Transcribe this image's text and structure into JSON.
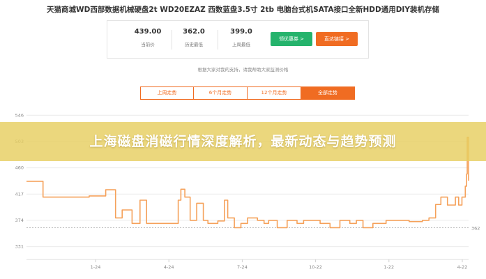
{
  "product": {
    "title": "天猫商城WD西部数据机械硬盘2t WD20EZAZ 西数蓝盘3.5寸 2tb 电脑台式机SATA接口全新HDD通用DIY装机存储"
  },
  "price_panel": {
    "stats": [
      {
        "value": "439.00",
        "label": "当前价"
      },
      {
        "value": "362.0",
        "label": "历史最低"
      },
      {
        "value": "399.0",
        "label": "上周最低"
      }
    ],
    "buttons": {
      "coupon": "领优惠券 >",
      "buy": "直达链接 >"
    }
  },
  "note": "根据大家对我的支持，请我帮助大家监测价格",
  "tabs": [
    {
      "label": "上周走势",
      "active": false
    },
    {
      "label": "6个月走势",
      "active": false
    },
    {
      "label": "12个月走势",
      "active": false
    },
    {
      "label": "全部走势",
      "active": true
    }
  ],
  "banner": {
    "text": "上海磁盘消磁行情深度解析，最新动态与趋势预测"
  },
  "chart_data": {
    "type": "line",
    "title": "",
    "xlabel": "",
    "ylabel": "",
    "x_ticks": [
      "1-24",
      "4-24",
      "7-24",
      "10-22",
      "1-22",
      "4-22"
    ],
    "y_ticks": [
      331,
      374,
      417,
      460,
      503,
      546
    ],
    "ylim": [
      310,
      552
    ],
    "reference_line": {
      "value": 362,
      "label": "362",
      "style": "dashed"
    },
    "grid": "horizontal",
    "line_color": "#f5a15a",
    "series": [
      {
        "points": [
          [
            0,
            438
          ],
          [
            25,
            438
          ],
          [
            25,
            412
          ],
          [
            95,
            412
          ],
          [
            95,
            414
          ],
          [
            120,
            414
          ],
          [
            120,
            424
          ],
          [
            135,
            424
          ],
          [
            135,
            378
          ],
          [
            145,
            378
          ],
          [
            145,
            391
          ],
          [
            160,
            391
          ],
          [
            160,
            369
          ],
          [
            172,
            369
          ],
          [
            172,
            407
          ],
          [
            182,
            407
          ],
          [
            182,
            369
          ],
          [
            230,
            369
          ],
          [
            230,
            407
          ],
          [
            234,
            407
          ],
          [
            234,
            425
          ],
          [
            240,
            425
          ],
          [
            240,
            412
          ],
          [
            248,
            412
          ],
          [
            248,
            374
          ],
          [
            258,
            374
          ],
          [
            258,
            402
          ],
          [
            268,
            402
          ],
          [
            268,
            374
          ],
          [
            275,
            374
          ],
          [
            275,
            369
          ],
          [
            290,
            369
          ],
          [
            290,
            373
          ],
          [
            300,
            373
          ],
          [
            300,
            407
          ],
          [
            305,
            407
          ],
          [
            305,
            378
          ],
          [
            315,
            378
          ],
          [
            315,
            362
          ],
          [
            325,
            362
          ],
          [
            325,
            369
          ],
          [
            335,
            369
          ],
          [
            335,
            378
          ],
          [
            350,
            378
          ],
          [
            350,
            374
          ],
          [
            360,
            374
          ],
          [
            360,
            369
          ],
          [
            367,
            369
          ],
          [
            367,
            374
          ],
          [
            380,
            374
          ],
          [
            380,
            362
          ],
          [
            395,
            362
          ],
          [
            395,
            374
          ],
          [
            410,
            374
          ],
          [
            410,
            369
          ],
          [
            420,
            369
          ],
          [
            420,
            374
          ],
          [
            445,
            374
          ],
          [
            445,
            369
          ],
          [
            460,
            369
          ],
          [
            460,
            362
          ],
          [
            475,
            362
          ],
          [
            475,
            374
          ],
          [
            490,
            374
          ],
          [
            490,
            369
          ],
          [
            500,
            369
          ],
          [
            500,
            374
          ],
          [
            510,
            374
          ],
          [
            510,
            362
          ],
          [
            525,
            362
          ],
          [
            525,
            369
          ],
          [
            545,
            369
          ],
          [
            545,
            374
          ],
          [
            580,
            374
          ],
          [
            580,
            372
          ],
          [
            600,
            372
          ],
          [
            600,
            374
          ],
          [
            610,
            374
          ],
          [
            610,
            378
          ],
          [
            620,
            378
          ],
          [
            620,
            400
          ],
          [
            628,
            400
          ],
          [
            628,
            412
          ],
          [
            638,
            412
          ],
          [
            638,
            399
          ],
          [
            650,
            399
          ],
          [
            650,
            412
          ],
          [
            655,
            412
          ],
          [
            655,
            399
          ],
          [
            660,
            399
          ],
          [
            660,
            412
          ],
          [
            665,
            412
          ],
          [
            665,
            430
          ],
          [
            667,
            430
          ],
          [
            667,
            450
          ],
          [
            668,
            450
          ],
          [
            668,
            510
          ],
          [
            670,
            510
          ],
          [
            670,
            439
          ]
        ]
      }
    ]
  }
}
